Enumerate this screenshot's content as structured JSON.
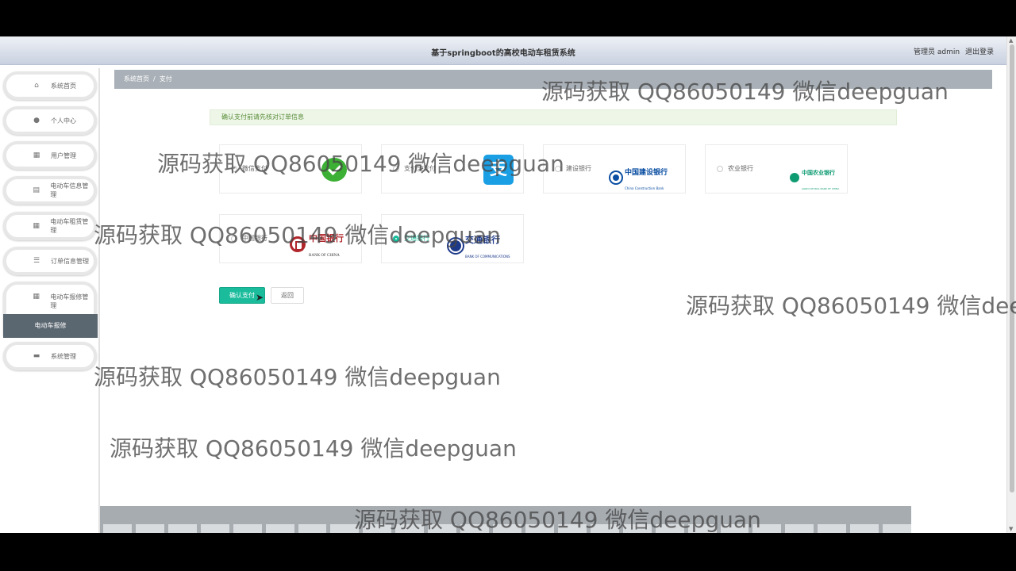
{
  "header": {
    "title": "基于springboot的高校电动车租赁系统",
    "user_label": "管理员 admin",
    "logout_label": "退出登录"
  },
  "sidebar": {
    "items": [
      {
        "icon": "home-icon",
        "label": "系统首页"
      },
      {
        "icon": "user-icon",
        "label": "个人中心"
      },
      {
        "icon": "grid-icon",
        "label": "用户管理"
      },
      {
        "icon": "list-icon",
        "label": "电动车信息管理"
      },
      {
        "icon": "grid-icon",
        "label": "电动车租赁管理"
      },
      {
        "icon": "sliders-icon",
        "label": "订单信息管理"
      },
      {
        "icon": "grid-icon",
        "label": "电动车报修管理"
      },
      {
        "icon": "chat-icon",
        "label": "系统管理"
      }
    ],
    "submenu_active": "电动车报修"
  },
  "breadcrumb": {
    "home": "系统首页",
    "sep": "/",
    "current": "支付"
  },
  "notice": "确认支付前请先核对订单信息",
  "payment_options": [
    {
      "name": "微信支付",
      "logo": "wechat-logo",
      "checked": false
    },
    {
      "name": "支付宝支付",
      "logo": "alipay-logo",
      "checked": false
    },
    {
      "name": "建设银行",
      "logo": "ccb-logo",
      "logo_text": "中国建设银行",
      "logo_sub": "China Construction Bank",
      "checked": false
    },
    {
      "name": "农业银行",
      "logo": "abc-logo",
      "logo_text": "中国农业银行",
      "logo_sub": "AGRICULTURAL BANK OF CHINA",
      "checked": false
    },
    {
      "name": "中国银行",
      "logo": "boc-logo",
      "logo_text": "中国银行",
      "logo_sub": "BANK OF CHINA",
      "checked": false
    },
    {
      "name": "交通银行",
      "logo": "bcm-logo",
      "logo_text": "交通银行",
      "logo_sub": "BANK OF COMMUNICATIONS",
      "checked": true
    }
  ],
  "buttons": {
    "confirm": "确认支付",
    "back": "返回"
  },
  "watermark": "源码获取 QQ86050149 微信deepguan",
  "colors": {
    "accent": "#1abc9c",
    "breadcrumb_bg": "#a9b0b7",
    "submenu_bg": "#5b6770"
  }
}
